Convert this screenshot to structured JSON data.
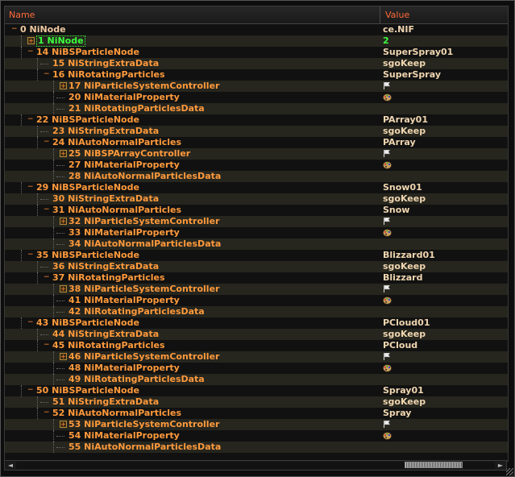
{
  "header": {
    "name_col": "Name",
    "value_col": "Value"
  },
  "rows": [
    {
      "label": "0 NiNode",
      "value": "ce.NIF",
      "depth": 0,
      "toggle": "minus",
      "kind": "hdr",
      "value_icon": ""
    },
    {
      "label": "1 NiNode",
      "value": "2",
      "depth": 1,
      "toggle": "plus",
      "kind": "sel",
      "value_icon": ""
    },
    {
      "label": "14 NiBSParticleNode",
      "value": "SuperSpray01",
      "depth": 1,
      "toggle": "minus",
      "kind": "node",
      "value_icon": ""
    },
    {
      "label": "15 NiStringExtraData",
      "value": "sgoKeep",
      "depth": 2,
      "toggle": "",
      "kind": "node",
      "value_icon": ""
    },
    {
      "label": "16 NiRotatingParticles",
      "value": "SuperSpray",
      "depth": 2,
      "toggle": "minus",
      "kind": "node",
      "value_icon": ""
    },
    {
      "label": "17 NiParticleSystemController",
      "value": "",
      "depth": 3,
      "toggle": "plus",
      "kind": "node",
      "value_icon": "flag"
    },
    {
      "label": "20 NiMaterialProperty",
      "value": "",
      "depth": 3,
      "toggle": "",
      "kind": "node",
      "value_icon": "palette"
    },
    {
      "label": "21 NiRotatingParticlesData",
      "value": "",
      "depth": 3,
      "toggle": "",
      "kind": "node",
      "value_icon": ""
    },
    {
      "label": "22 NiBSParticleNode",
      "value": "PArray01",
      "depth": 1,
      "toggle": "minus",
      "kind": "node",
      "value_icon": ""
    },
    {
      "label": "23 NiStringExtraData",
      "value": "sgoKeep",
      "depth": 2,
      "toggle": "",
      "kind": "node",
      "value_icon": ""
    },
    {
      "label": "24 NiAutoNormalParticles",
      "value": "PArray",
      "depth": 2,
      "toggle": "minus",
      "kind": "node",
      "value_icon": ""
    },
    {
      "label": "25 NiBSPArrayController",
      "value": "",
      "depth": 3,
      "toggle": "plus",
      "kind": "node",
      "value_icon": "flag"
    },
    {
      "label": "27 NiMaterialProperty",
      "value": "",
      "depth": 3,
      "toggle": "",
      "kind": "node",
      "value_icon": "palette"
    },
    {
      "label": "28 NiAutoNormalParticlesData",
      "value": "",
      "depth": 3,
      "toggle": "",
      "kind": "node",
      "value_icon": ""
    },
    {
      "label": "29 NiBSParticleNode",
      "value": "Snow01",
      "depth": 1,
      "toggle": "minus",
      "kind": "node",
      "value_icon": ""
    },
    {
      "label": "30 NiStringExtraData",
      "value": "sgoKeep",
      "depth": 2,
      "toggle": "",
      "kind": "node",
      "value_icon": ""
    },
    {
      "label": "31 NiAutoNormalParticles",
      "value": "Snow",
      "depth": 2,
      "toggle": "minus",
      "kind": "node",
      "value_icon": ""
    },
    {
      "label": "32 NiParticleSystemController",
      "value": "",
      "depth": 3,
      "toggle": "plus",
      "kind": "node",
      "value_icon": "flag"
    },
    {
      "label": "33 NiMaterialProperty",
      "value": "",
      "depth": 3,
      "toggle": "",
      "kind": "node",
      "value_icon": "palette"
    },
    {
      "label": "34 NiAutoNormalParticlesData",
      "value": "",
      "depth": 3,
      "toggle": "",
      "kind": "node",
      "value_icon": ""
    },
    {
      "label": "35 NiBSParticleNode",
      "value": "Blizzard01",
      "depth": 1,
      "toggle": "minus",
      "kind": "node",
      "value_icon": ""
    },
    {
      "label": "36 NiStringExtraData",
      "value": "sgoKeep",
      "depth": 2,
      "toggle": "",
      "kind": "node",
      "value_icon": ""
    },
    {
      "label": "37 NiRotatingParticles",
      "value": "Blizzard",
      "depth": 2,
      "toggle": "minus",
      "kind": "node",
      "value_icon": ""
    },
    {
      "label": "38 NiParticleSystemController",
      "value": "",
      "depth": 3,
      "toggle": "plus",
      "kind": "node",
      "value_icon": "flag"
    },
    {
      "label": "41 NiMaterialProperty",
      "value": "",
      "depth": 3,
      "toggle": "",
      "kind": "node",
      "value_icon": "palette"
    },
    {
      "label": "42 NiRotatingParticlesData",
      "value": "",
      "depth": 3,
      "toggle": "",
      "kind": "node",
      "value_icon": ""
    },
    {
      "label": "43 NiBSParticleNode",
      "value": "PCloud01",
      "depth": 1,
      "toggle": "minus",
      "kind": "node",
      "value_icon": ""
    },
    {
      "label": "44 NiStringExtraData",
      "value": "sgoKeep",
      "depth": 2,
      "toggle": "",
      "kind": "node",
      "value_icon": ""
    },
    {
      "label": "45 NiRotatingParticles",
      "value": "PCloud",
      "depth": 2,
      "toggle": "minus",
      "kind": "node",
      "value_icon": ""
    },
    {
      "label": "46 NiParticleSystemController",
      "value": "",
      "depth": 3,
      "toggle": "plus",
      "kind": "node",
      "value_icon": "flag"
    },
    {
      "label": "48 NiMaterialProperty",
      "value": "",
      "depth": 3,
      "toggle": "",
      "kind": "node",
      "value_icon": "palette"
    },
    {
      "label": "49 NiRotatingParticlesData",
      "value": "",
      "depth": 3,
      "toggle": "",
      "kind": "node",
      "value_icon": ""
    },
    {
      "label": "50 NiBSParticleNode",
      "value": "Spray01",
      "depth": 1,
      "toggle": "minus",
      "kind": "node",
      "value_icon": ""
    },
    {
      "label": "51 NiStringExtraData",
      "value": "sgoKeep",
      "depth": 2,
      "toggle": "",
      "kind": "node",
      "value_icon": ""
    },
    {
      "label": "52 NiAutoNormalParticles",
      "value": "Spray",
      "depth": 2,
      "toggle": "minus",
      "kind": "node",
      "value_icon": ""
    },
    {
      "label": "53 NiParticleSystemController",
      "value": "",
      "depth": 3,
      "toggle": "plus",
      "kind": "node",
      "value_icon": "flag"
    },
    {
      "label": "54 NiMaterialProperty",
      "value": "",
      "depth": 3,
      "toggle": "",
      "kind": "node",
      "value_icon": "palette"
    },
    {
      "label": "55 NiAutoNormalParticlesData",
      "value": "",
      "depth": 3,
      "toggle": "",
      "kind": "node",
      "value_icon": ""
    }
  ],
  "scrollbar": {
    "left_arrow": "◄",
    "right_arrow": "►"
  },
  "colors": {
    "accent": "#ff9a3c",
    "selected": "#3cff3c",
    "header_text": "#ff6a3a",
    "value_text": "#f0d6b0"
  }
}
